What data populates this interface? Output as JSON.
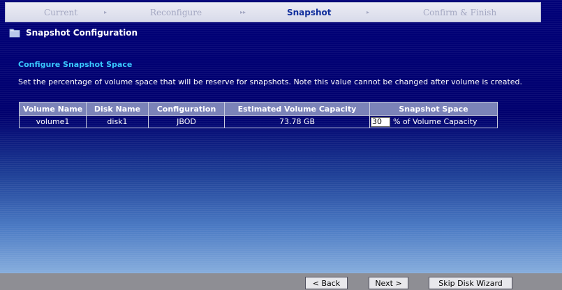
{
  "wizard": {
    "steps": [
      {
        "label": "Current",
        "active": false
      },
      {
        "label": "Reconfigure",
        "active": false
      },
      {
        "label": "Snapshot",
        "active": true
      },
      {
        "label": "Confirm & Finish",
        "active": false
      }
    ],
    "separators": [
      "▸",
      "▸▸",
      "▸"
    ]
  },
  "page": {
    "title": "Snapshot Configuration",
    "icon": "folder-icon",
    "section_title": "Configure Snapshot Space",
    "description": "Set the percentage of volume space that will be reserve for snapshots. Note this value cannot be changed after volume is created."
  },
  "table": {
    "headers": [
      "Volume Name",
      "Disk Name",
      "Configuration",
      "Estimated Volume Capacity",
      "Snapshot Space"
    ],
    "rows": [
      {
        "volume_name": "volume1",
        "disk_name": "disk1",
        "configuration": "JBOD",
        "capacity": "73.78 GB",
        "snapshot_value": "30",
        "snapshot_unit": "% of Volume Capacity"
      }
    ]
  },
  "buttons": {
    "back": "< Back",
    "next": "Next >",
    "skip": "Skip Disk Wizard"
  },
  "colors": {
    "section_title": "#39c8ff",
    "active_step": "#102e9c",
    "header_bg": "#7b83b8"
  }
}
